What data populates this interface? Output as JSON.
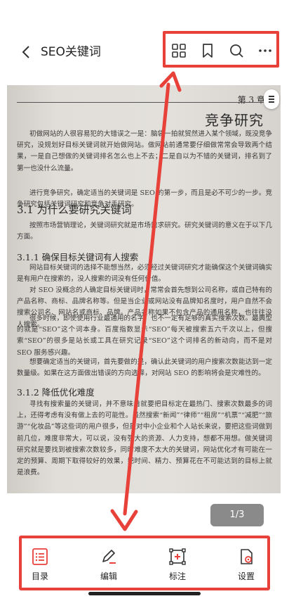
{
  "header": {
    "title": "SEO关键词"
  },
  "icons": {
    "back": "chevron-left-icon",
    "grid": "grid-icon",
    "bookmark": "bookmark-icon",
    "search": "search-icon",
    "more": "more-icon",
    "menu": "menu-icon"
  },
  "document": {
    "chapter": "第 3 章",
    "chapter_title": "竞争研究",
    "intro": "初做网站的人很容易犯的大错误之一是：脑袋一拍就贸然进入某个领域，既没竞争研究，没规划好目标关键词就开始做网站。做网站前通常要仔细做常常会导致两个结果，一是自己想做的关键词排名怎么也上不去；二是自以为不错的关键词，排名到了第一也没什么流量。",
    "intro2": "进行竞争研究，确定适当的关键词是 SEO 的第一步，而且是必不可少的一步。竞争研究包括关键词研究和竞争对手研究。",
    "sec31": "3.1 为什么要研究关键词",
    "sec31_text": "按照市场营销理论，关键词研究就是市场需求研究。研究关键词的意义在于以下几方面。",
    "sec311": "3.1.1 确保目标关键词有人搜索",
    "sec311_text1": "网站目标关键词的选择不能想当然，必须经过关键词研究才能确保这个关键词确实是有用户在搜索的，没人搜索的词没有任何价值。",
    "sec311_text2": "对 SEO 没概念的人确定目标关键词时，常常会首先想到公司名称，或自己特有的产品名称、商标、品牌名称等。但是当企业或网站没有品牌知名度时，用户自然不会搜索公司名、网站名或商标、品牌。产品名称如果不包含产品的通用名称，也往往没人搜索。",
    "sec311_text3": "很多时候，即使使用行业最通用的名字，也不一定有足够的真实搜索次数。最典型的就是“SEO”这个词本身。百度指数显示“SEO”每天被搜索五六千次以上，但搜索“SEO”的很多是站长或工具在研究记录“SEO”这个词排名的新动向，而不是对 SEO 服务感兴趣。",
    "sec311_text4": "想要确定适当的关键词，首先要做的是，确认此关键词的用户搜索次数能达到一定数量级。如果在这方面做出错误的方向选择，对网站 SEO 的影响将会是灾难性的。",
    "sec312": "3.1.2 降低优化难度",
    "sec312_text": "寻找有搜索量的关键词，并不意味着就要把目标定在最热门、搜索次数最多的词上，还得考虑有没有做上去的可能性。虽然搜索“新闻”“律师”“租房”“机票”“减肥”“旅游”“化妆品”等这些词的用户很多，但是对中小企业和个人站长来说，要把这些词做到前几位，难度非常大，可以说，没有强大的资源、人力支持，想都不用想。做关键词研究就是要找到被搜索次数较多，同时难度不太大的关键词，网站优化才有可能在一定的预算、周期下取得较好的效果，把时间、精力、预算花在不可能达到的目标上就是浪费。"
  },
  "pager": {
    "label": "1/3"
  },
  "toolbar": {
    "toc": {
      "label": "目录",
      "icon": "list-icon"
    },
    "edit": {
      "label": "编辑",
      "icon": "pen-icon"
    },
    "annotate": {
      "label": "标注",
      "icon": "annotate-icon"
    },
    "settings": {
      "label": "设置",
      "icon": "settings-icon"
    }
  },
  "colors": {
    "highlight": "#e8413a",
    "pager_bg": "#8a8a8a"
  }
}
